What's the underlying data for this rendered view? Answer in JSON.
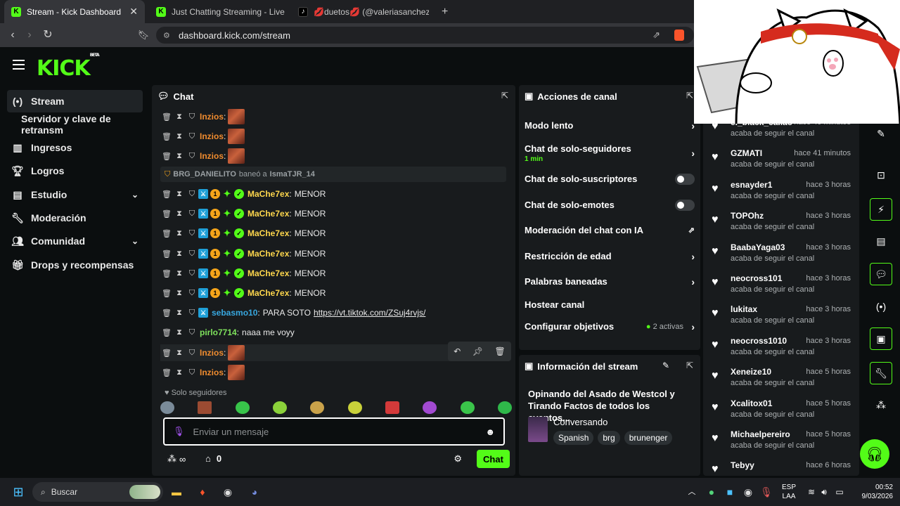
{
  "browser": {
    "tabs": [
      {
        "label": "Stream - Kick Dashboard",
        "active": true
      },
      {
        "label": "Just Chatting Streaming - Live Stream",
        "active": false
      },
      {
        "label": "💋duetos💋 (@valeriasanchezzr) | Tr",
        "active": false
      }
    ],
    "new_tab": "+",
    "url": "dashboard.kick.com/stream"
  },
  "brand": {
    "logo": "KICK",
    "beta": "BETA",
    "accent": "#53fc18"
  },
  "sidebar": {
    "items": [
      {
        "label": "Stream",
        "icon": "broadcast-icon"
      },
      {
        "label": "Servidor y clave de retransm",
        "icon": ""
      },
      {
        "label": "Ingresos",
        "icon": "chart-icon"
      },
      {
        "label": "Logros",
        "icon": "trophy-icon"
      },
      {
        "label": "Estudio",
        "icon": "studio-icon"
      },
      {
        "label": "Moderación",
        "icon": "wrench-icon"
      },
      {
        "label": "Comunidad",
        "icon": "users-icon"
      },
      {
        "label": "Drops y recompensas",
        "icon": "gift-icon"
      }
    ]
  },
  "chat": {
    "title": "Chat",
    "ban_notice": {
      "user": "BRG_DANIELITO",
      "action": "baneó a",
      "target": "IsmaTJR_14"
    },
    "messages": [
      {
        "user": "Inzios",
        "sep": ":",
        "text": "",
        "color": "#f08c2f"
      },
      {
        "user": "Inzios",
        "sep": ":",
        "text": "",
        "color": "#f08c2f"
      },
      {
        "user": "Inzios",
        "sep": ":",
        "text": "",
        "color": "#f08c2f"
      },
      {
        "user": "MaChe7ex",
        "sep": ":",
        "text": "MENOR",
        "color": "#ffd84d"
      },
      {
        "user": "MaChe7ex",
        "sep": ":",
        "text": "MENOR",
        "color": "#ffd84d"
      },
      {
        "user": "MaChe7ex",
        "sep": ":",
        "text": "MENOR",
        "color": "#ffd84d"
      },
      {
        "user": "MaChe7ex",
        "sep": ":",
        "text": "MENOR",
        "color": "#ffd84d"
      },
      {
        "user": "MaChe7ex",
        "sep": ":",
        "text": "MENOR",
        "color": "#ffd84d"
      },
      {
        "user": "MaChe7ex",
        "sep": ":",
        "text": "MENOR",
        "color": "#ffd84d"
      },
      {
        "user": "sebasmo10",
        "sep": ":",
        "text": "PARA SOTO",
        "link": "https://vt.tiktok.com/ZSuj4rvjs/",
        "color": "#38a8e0"
      },
      {
        "user": "pirlo7714",
        "sep": ":",
        "text": "naaa me voyy",
        "color": "#7ee15c"
      },
      {
        "user": "Inzios",
        "sep": ":",
        "text": "",
        "color": "#f08c2f"
      },
      {
        "user": "Inzios",
        "sep": ":",
        "text": "",
        "color": "#f08c2f"
      }
    ],
    "followers_only": "Solo seguidores",
    "input_placeholder": "Enviar un mensaje",
    "infinity": "∞",
    "points": "0",
    "send_label": "Chat"
  },
  "channel_actions": {
    "title": "Acciones de canal",
    "items": [
      {
        "label": "Modo lento",
        "sub": "",
        "control": "chevron"
      },
      {
        "label": "Chat de solo-seguidores",
        "sub": "1 min",
        "control": "chevron"
      },
      {
        "label": "Chat de solo-suscriptores",
        "sub": "",
        "control": "toggle"
      },
      {
        "label": "Chat de solo-emotes",
        "sub": "",
        "control": "toggle"
      },
      {
        "label": "Moderación del chat con IA",
        "sub": "",
        "control": "external"
      },
      {
        "label": "Restricción de edad",
        "sub": "",
        "control": "chevron"
      },
      {
        "label": "Palabras baneadas",
        "sub": "",
        "control": "chevron"
      },
      {
        "label": "Hostear canal",
        "sub": "",
        "control": "none"
      },
      {
        "label": "Configurar objetivos",
        "sub": "",
        "control": "chevron",
        "status": "2 activas"
      }
    ]
  },
  "stream_info": {
    "title": "Información del stream",
    "stream_title": "Opinando del Asado de Westcol y Tirando Factos de todos los eventos...",
    "category": "Conversando",
    "tags": [
      "Spanish",
      "brg",
      "brunenger"
    ]
  },
  "activity": {
    "items": [
      {
        "user": "el_black_callao",
        "time": "hace 40 minutos",
        "action": "acaba de seguir el canal"
      },
      {
        "user": "GZMATI",
        "time": "hace 41 minutos",
        "action": "acaba de seguir el canal"
      },
      {
        "user": "esnayder1",
        "time": "hace 3 horas",
        "action": "acaba de seguir el canal"
      },
      {
        "user": "TOPOhz",
        "time": "hace 3 horas",
        "action": "acaba de seguir el canal"
      },
      {
        "user": "BaabaYaga03",
        "time": "hace 3 horas",
        "action": "acaba de seguir el canal"
      },
      {
        "user": "neocross101",
        "time": "hace 3 horas",
        "action": "acaba de seguir el canal"
      },
      {
        "user": "lukitax",
        "time": "hace 3 horas",
        "action": "acaba de seguir el canal"
      },
      {
        "user": "neocross1010",
        "time": "hace 3 horas",
        "action": "acaba de seguir el canal"
      },
      {
        "user": "Xeneize10",
        "time": "hace 5 horas",
        "action": "acaba de seguir el canal"
      },
      {
        "user": "Xcalitox01",
        "time": "hace 5 horas",
        "action": "acaba de seguir el canal"
      },
      {
        "user": "Michaelpereiro",
        "time": "hace 5 horas",
        "action": "acaba de seguir el canal"
      },
      {
        "user": "Tebyy",
        "time": "hace 6 horas",
        "action": ""
      }
    ]
  },
  "taskbar": {
    "search": "Buscar",
    "lang": "ESP",
    "lang2": "LAA",
    "time": "00:52",
    "date": "9/03/2026"
  }
}
